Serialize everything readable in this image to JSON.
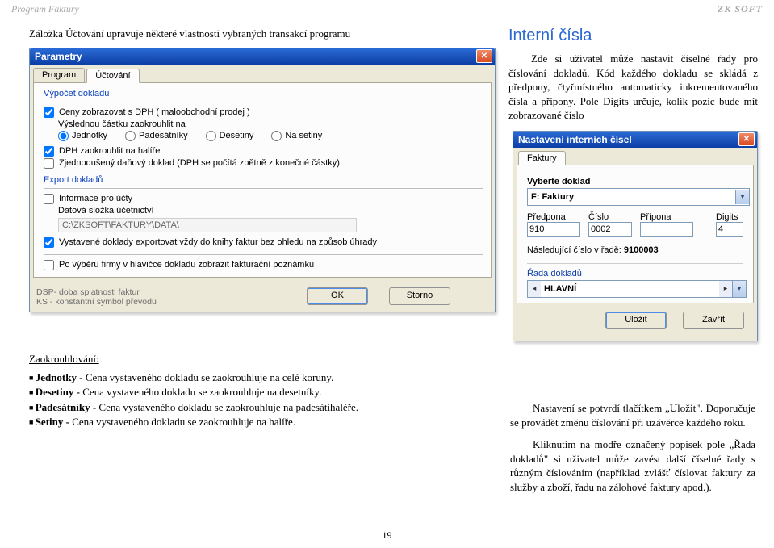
{
  "header": {
    "left": "Program Faktury",
    "brand": "ZK SOFT"
  },
  "intro": "Záložka Účtování upravuje některé vlastnosti vybraných transakcí programu",
  "win1": {
    "title": "Parametry",
    "tabs": {
      "program": "Program",
      "uctovani": "Účtování"
    },
    "section_vypocet": "Výpočet dokladu",
    "c1": "Ceny zobrazovat s DPH ( maloobchodní prodej )",
    "round_lbl": "Výslednou částku zaokrouhlit na",
    "radios": {
      "jednotky": "Jednotky",
      "padesatniky": "Padesátníky",
      "desetiny": "Desetiny",
      "setiny": "Na setiny"
    },
    "c2": "DPH zaokrouhlit na halíře",
    "c3": "Zjednodušený daňový doklad (DPH se počítá zpětně z konečné částky)",
    "section_export": "Export dokladů",
    "c4": "Informace pro účty",
    "data_lbl": "Datová složka účetnictví",
    "data_path": "C:\\ZKSOFT\\FAKTURY\\DATA\\",
    "c5": "Vystavené doklady exportovat vždy do knihy faktur bez ohledu na způsob úhrady",
    "c6": "Po výběru firmy v hlavičce dokladu zobrazit fakturační poznámku",
    "footer1": "DSP- doba splatnosti faktur",
    "footer2": "KS - konstantní symbol převodu",
    "btn_ok": "OK",
    "btn_storno": "Storno"
  },
  "rt": {
    "heading": "Interní čísla",
    "p1": "Zde si uživatel může nastavit číselné řady pro číslování dokladů. Kód každého dokladu se skládá z předpony, čtyřmístného automaticky inkrementovaného čísla a přípony. Pole Digits určuje, kolik pozic bude mít zobrazované číslo"
  },
  "win2": {
    "title": "Nastavení interních čísel",
    "tab": "Faktury",
    "vyberte": "Vyberte doklad",
    "doc_selected": "F: Faktury",
    "f_predpona_lbl": "Předpona",
    "f_cislo_lbl": "Číslo",
    "f_pripona_lbl": "Přípona",
    "f_digits_lbl": "Digits",
    "f_predpona": "910",
    "f_cislo": "0002",
    "f_pripona": "",
    "f_digits": "4",
    "next_lbl": "Následující číslo v řadě:",
    "next_val": "9100003",
    "rada_lbl": "Řada dokladů",
    "rada_val": "HLAVNÍ",
    "btn_save": "Uložit",
    "btn_close": "Zavřít"
  },
  "below_right": {
    "p2": "Nastavení se potvrdí tlačítkem „Uložit\". Doporučuje se provádět změnu číslování při uzávěrce každého roku.",
    "p3": "Kliknutím na modře označený popisek pole „Řada dokladů\" si uživatel může zavést další číselné řady s různým číslováním (například zvlášť číslovat faktury za služby a zboží, řadu na zálohové faktury apod.)."
  },
  "zaok": {
    "title": "Zaokrouhlování:",
    "r1_b": "Jednotky -",
    "r1": "Cena  vystaveného dokladu se zaokrouhluje na celé koruny.",
    "r2_b": "Desetiny -",
    "r2": "Cena  vystaveného dokladu se zaokrouhluje na desetníky.",
    "r3_b": "Padesátníky -",
    "r3": "Cena  vystaveného dokladu se zaokrouhluje na padesátihaléře.",
    "r4_b": "Setiny -",
    "r4": "Cena  vystaveného dokladu se zaokrouhluje na halíře."
  },
  "page": "19"
}
